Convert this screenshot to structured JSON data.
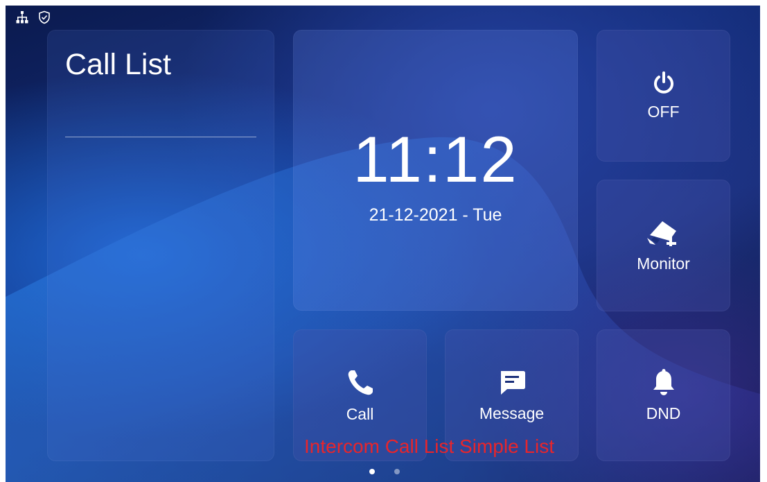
{
  "status_bar": {
    "icons": [
      "network-icon",
      "shield-check-icon"
    ]
  },
  "call_list": {
    "title": "Call List"
  },
  "clock": {
    "time": "11:12",
    "date": "21-12-2021 - Tue"
  },
  "actions": {
    "power": {
      "label": "OFF",
      "icon": "power-icon"
    },
    "monitor": {
      "label": "Monitor",
      "icon": "camera-icon"
    },
    "dnd": {
      "label": "DND",
      "icon": "bell-icon"
    },
    "call": {
      "label": "Call",
      "icon": "phone-icon"
    },
    "message": {
      "label": "Message",
      "icon": "message-icon"
    }
  },
  "caption": "Intercom Call List Simple List",
  "pager": {
    "pages": 2,
    "active_page": 1
  },
  "colors": {
    "caption": "#e8252b",
    "text": "#ffffff"
  }
}
